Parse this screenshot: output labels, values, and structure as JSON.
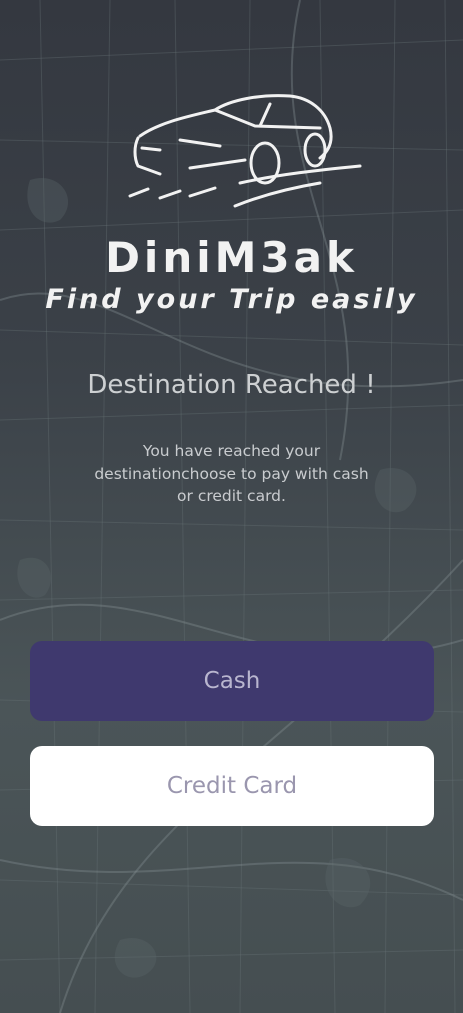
{
  "brand": {
    "name": "DiniM3ak",
    "tagline": "Find your Trip easily",
    "logo_icon": "car-icon"
  },
  "screen": {
    "title": "Destination Reached !",
    "message": "You have reached your destinationchoose to pay with cash or credit card."
  },
  "buttons": {
    "cash_label": "Cash",
    "credit_card_label": "Credit Card"
  },
  "colors": {
    "cash_button": "#3f396e",
    "credit_card_button": "#ffffff",
    "background": "#3b4148"
  }
}
